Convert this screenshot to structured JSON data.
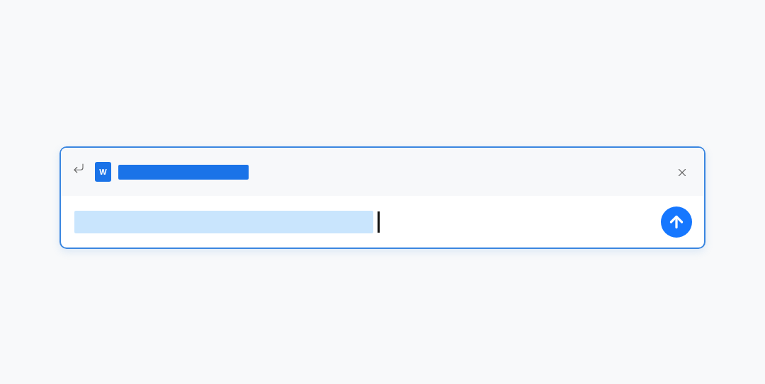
{
  "reply_context": {
    "kind": "word",
    "file_icon_letter": "W"
  },
  "composer": {
    "focused": true,
    "text_selected": true
  }
}
